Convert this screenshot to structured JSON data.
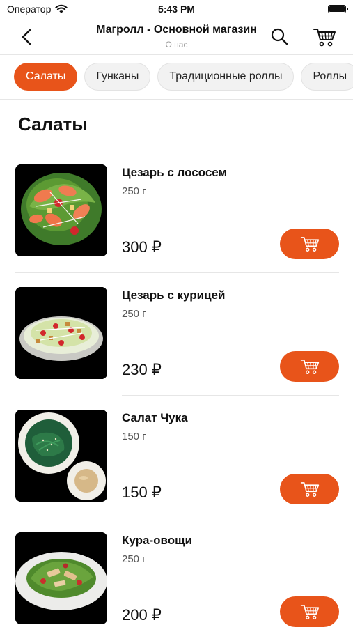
{
  "status": {
    "carrier": "Оператор",
    "time": "5:43 PM"
  },
  "header": {
    "title": "Магролл - Основной магазин",
    "subtitle": "О нас"
  },
  "categories": [
    "Салаты",
    "Гунканы",
    "Традиционные роллы",
    "Роллы"
  ],
  "section": {
    "title": "Салаты"
  },
  "colors": {
    "accent": "#e8541a"
  },
  "products": [
    {
      "name": "Цезарь с лососем",
      "weight": "250 г",
      "price": "300 ₽",
      "image": "caesar-salmon-salad-photo"
    },
    {
      "name": "Цезарь с курицей",
      "weight": "250 г",
      "price": "230 ₽",
      "image": "caesar-chicken-salad-photo"
    },
    {
      "name": "Салат Чука",
      "weight": "150 г",
      "price": "150 ₽",
      "image": "chuka-salad-photo"
    },
    {
      "name": "Кура-овощи",
      "weight": "250 г",
      "price": "200 ₽",
      "image": "chicken-vegetables-salad-photo"
    }
  ]
}
